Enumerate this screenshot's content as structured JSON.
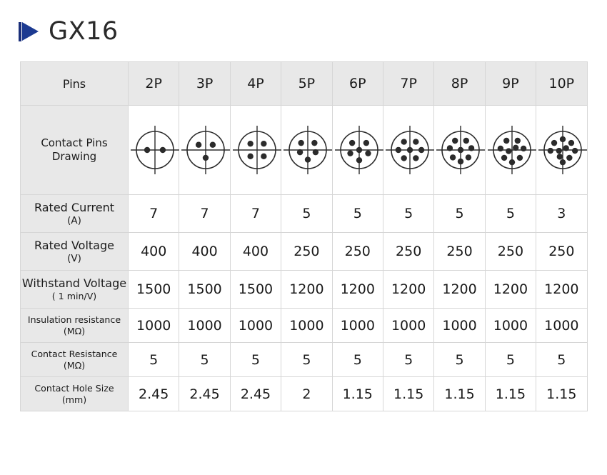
{
  "header": {
    "title": "GX16",
    "marker_icon": "play-triangle-icon",
    "marker_color": "#1c3a91"
  },
  "table": {
    "corner_label": "Pins",
    "columns": [
      "2P",
      "3P",
      "4P",
      "5P",
      "6P",
      "7P",
      "8P",
      "9P",
      "10P"
    ],
    "drawing_row": {
      "label_line1": "Contact Pins",
      "label_line2": "Drawing",
      "pin_layouts": [
        {
          "name": "2P",
          "dots": [
            [
              -0.42,
              0.0
            ],
            [
              0.42,
              0.0
            ]
          ]
        },
        {
          "name": "3P",
          "dots": [
            [
              -0.38,
              -0.28
            ],
            [
              0.38,
              -0.28
            ],
            [
              0.0,
              0.42
            ]
          ]
        },
        {
          "name": "4P",
          "dots": [
            [
              -0.36,
              -0.34
            ],
            [
              0.36,
              -0.34
            ],
            [
              -0.36,
              0.34
            ],
            [
              0.36,
              0.34
            ]
          ]
        },
        {
          "name": "5P",
          "dots": [
            [
              -0.36,
              -0.38
            ],
            [
              0.36,
              -0.38
            ],
            [
              -0.42,
              0.12
            ],
            [
              0.42,
              0.12
            ],
            [
              0.0,
              0.52
            ]
          ]
        },
        {
          "name": "6P",
          "dots": [
            [
              0.0,
              0.0
            ],
            [
              -0.38,
              -0.38
            ],
            [
              0.38,
              -0.38
            ],
            [
              -0.48,
              0.18
            ],
            [
              0.48,
              0.18
            ],
            [
              0.0,
              0.55
            ]
          ]
        },
        {
          "name": "7P",
          "dots": [
            [
              0.0,
              0.0
            ],
            [
              -0.32,
              -0.44
            ],
            [
              0.32,
              -0.44
            ],
            [
              -0.62,
              0.0
            ],
            [
              0.62,
              0.0
            ],
            [
              -0.32,
              0.44
            ],
            [
              0.32,
              0.44
            ]
          ]
        },
        {
          "name": "8P",
          "dots": [
            [
              0.0,
              0.0
            ],
            [
              -0.3,
              -0.5
            ],
            [
              0.3,
              -0.5
            ],
            [
              -0.58,
              -0.1
            ],
            [
              0.58,
              -0.1
            ],
            [
              -0.42,
              0.4
            ],
            [
              0.42,
              0.4
            ],
            [
              0.0,
              0.62
            ]
          ]
        },
        {
          "name": "9P",
          "dots": [
            [
              -0.18,
              0.06
            ],
            [
              0.2,
              -0.12
            ],
            [
              -0.3,
              -0.5
            ],
            [
              0.3,
              -0.5
            ],
            [
              -0.62,
              -0.08
            ],
            [
              0.62,
              -0.08
            ],
            [
              -0.42,
              0.42
            ],
            [
              0.42,
              0.42
            ],
            [
              0.0,
              0.66
            ]
          ]
        },
        {
          "name": "10P",
          "dots": [
            [
              -0.2,
              0.04
            ],
            [
              0.18,
              -0.1
            ],
            [
              -0.16,
              0.36
            ],
            [
              0.0,
              -0.58
            ],
            [
              -0.46,
              -0.38
            ],
            [
              0.46,
              -0.38
            ],
            [
              -0.66,
              0.04
            ],
            [
              0.66,
              0.04
            ],
            [
              0.36,
              0.42
            ],
            [
              0.0,
              0.66
            ]
          ]
        }
      ]
    },
    "rows": [
      {
        "id": "rated-current",
        "label": "Rated Current",
        "unit": "(A)",
        "small": false,
        "values": [
          "7",
          "7",
          "7",
          "5",
          "5",
          "5",
          "5",
          "5",
          "3"
        ]
      },
      {
        "id": "rated-voltage",
        "label": "Rated Voltage",
        "unit": "(V)",
        "small": false,
        "values": [
          "400",
          "400",
          "400",
          "250",
          "250",
          "250",
          "250",
          "250",
          "250"
        ]
      },
      {
        "id": "withstand-voltage",
        "label": "Withstand Voltage",
        "unit": "( 1 min/V)",
        "small": true,
        "values": [
          "1500",
          "1500",
          "1500",
          "1200",
          "1200",
          "1200",
          "1200",
          "1200",
          "1200"
        ]
      },
      {
        "id": "insulation-resistance",
        "label": "Insulation resistance",
        "unit": "(MΩ)",
        "small": true,
        "values": [
          "1000",
          "1000",
          "1000",
          "1000",
          "1000",
          "1000",
          "1000",
          "1000",
          "1000"
        ]
      },
      {
        "id": "contact-resistance",
        "label": "Contact Resistance",
        "unit": "(MΩ)",
        "small": true,
        "values": [
          "5",
          "5",
          "5",
          "5",
          "5",
          "5",
          "5",
          "5",
          "5"
        ]
      },
      {
        "id": "contact-hole-size",
        "label": "Contact Hole Size",
        "unit": "(mm)",
        "small": true,
        "values": [
          "2.45",
          "2.45",
          "2.45",
          "2",
          "1.15",
          "1.15",
          "1.15",
          "1.15",
          "1.15"
        ]
      }
    ]
  },
  "style": {
    "header_bg": "#e8e8e8",
    "border_color": "#d6d6d6",
    "text_color": "#1a1a1a"
  }
}
